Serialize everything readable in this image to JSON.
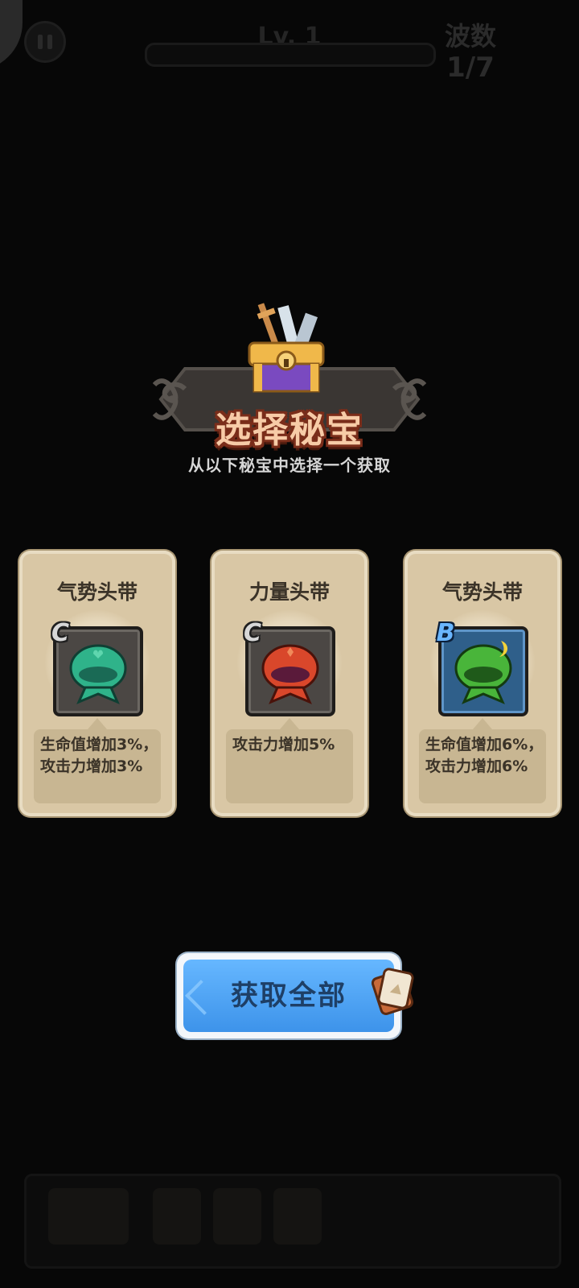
{
  "hud": {
    "level_label": "Lv. 1",
    "wave_label": "波数",
    "wave_value": "1/7"
  },
  "header": {
    "title": "选择秘宝",
    "subtitle": "从以下秘宝中选择一个获取"
  },
  "cards": [
    {
      "name": "气势头带",
      "grade": "C",
      "description": "生命值增加3%，攻击力增加3%",
      "color": "#2fb38a"
    },
    {
      "name": "力量头带",
      "grade": "C",
      "description": "攻击力增加5%",
      "color": "#d9472b"
    },
    {
      "name": "气势头带",
      "grade": "B",
      "description": "生命值增加6%，攻击力增加6%",
      "color": "#49b53a"
    }
  ],
  "actions": {
    "claim_all_label": "获取全部"
  },
  "icons": [
    "pause-icon",
    "treasure-chest-icon",
    "headband-icon",
    "ticket-icon"
  ],
  "colors": {
    "background": "#070707",
    "card": "#d9c7a5",
    "title": "#f7cba7",
    "button": "#4aa4f5"
  }
}
